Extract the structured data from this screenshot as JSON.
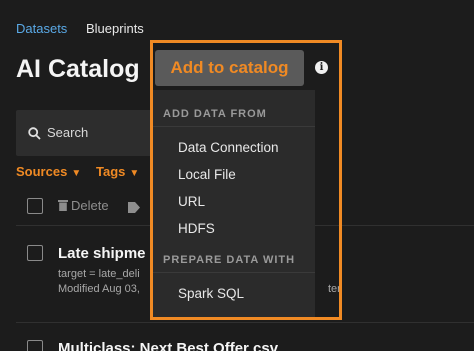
{
  "breadcrumb": {
    "datasets": "Datasets",
    "blueprints": "Blueprints"
  },
  "page_title": "AI Catalog",
  "search": {
    "label": "Search"
  },
  "filters": {
    "sources": "Sources",
    "tags": "Tags"
  },
  "bulk_actions": {
    "delete": "Delete"
  },
  "rows": [
    {
      "title": "Late shipme",
      "target": "target = late_deli",
      "modified": "Modified Aug 03,",
      "creator": "ter"
    },
    {
      "title": "Multiclass: Next Best Offer csv"
    }
  ],
  "add_button": {
    "label": "Add to catalog"
  },
  "menu": {
    "section_add": "ADD DATA FROM",
    "add_items": [
      "Data Connection",
      "Local File",
      "URL",
      "HDFS"
    ],
    "section_prepare": "PREPARE DATA WITH",
    "prepare_items": [
      "Spark SQL"
    ]
  },
  "colors": {
    "accent": "#f08a24",
    "link": "#5aa9e6",
    "background": "#1c1c1c"
  }
}
